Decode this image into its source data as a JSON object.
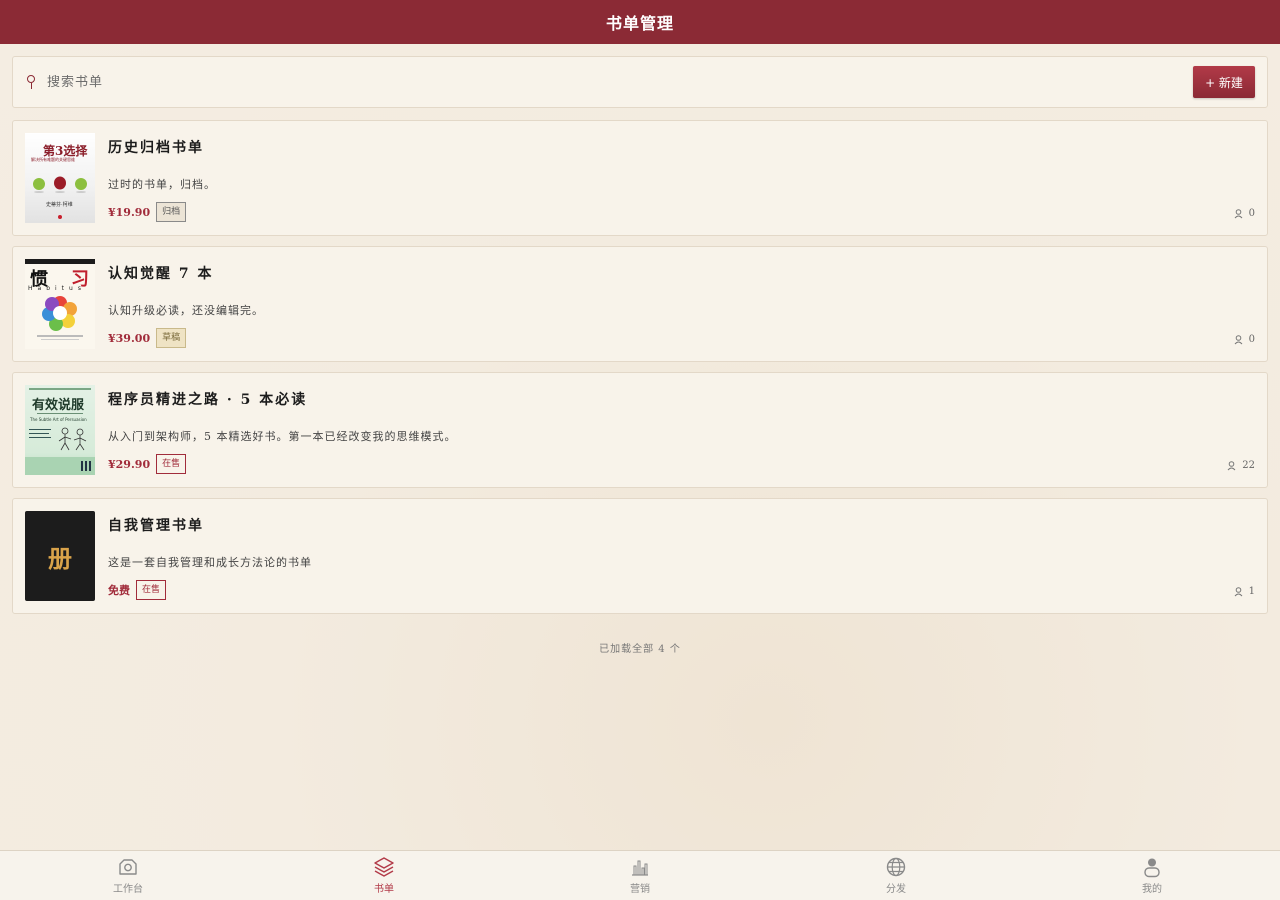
{
  "header": {
    "title": "书单管理"
  },
  "search": {
    "placeholder": "搜索书单",
    "new_label": "+ 新建"
  },
  "lists": [
    {
      "title": "历史归档书单",
      "desc": "过时的书单，归档。",
      "price": "¥19.90",
      "status": "归档",
      "count": "0",
      "cover": {
        "title": "第3选择",
        "subtitle": "解决所有难题的关键思维",
        "author": "史蒂芬·柯维"
      }
    },
    {
      "title": "认知觉醒 7 本",
      "desc": "认知升级必读，还没编辑完。",
      "price": "¥39.00",
      "status": "草稿",
      "count": "0",
      "cover": {
        "title_left": "惯",
        "title_right": "习",
        "latin": "Habitus"
      }
    },
    {
      "title": "程序员精进之路 · 5 本必读",
      "desc": "从入门到架构师，5 本精选好书。第一本已经改变我的思维模式。",
      "price": "¥29.90",
      "status": "在售",
      "count": "22",
      "cover": {
        "title": "有效说服",
        "english": "The Subtle Art of Persuasion"
      }
    },
    {
      "title": "自我管理书单",
      "desc": "这是一套自我管理和成长方法论的书单",
      "price": "免费",
      "status": "在售",
      "count": "1",
      "cover": {
        "glyph": "册"
      }
    }
  ],
  "footer_note": "已加载全部 4 个",
  "tabs": [
    {
      "label": "工作台",
      "icon": "camera-icon"
    },
    {
      "label": "书单",
      "icon": "layers-icon"
    },
    {
      "label": "营销",
      "icon": "bar-chart-icon"
    },
    {
      "label": "分发",
      "icon": "globe-icon"
    },
    {
      "label": "我的",
      "icon": "user-icon"
    }
  ],
  "colors": {
    "primary": "#8b2a35",
    "accent": "#b23a48",
    "background": "#f4ede2",
    "card": "#f8f3ea"
  }
}
